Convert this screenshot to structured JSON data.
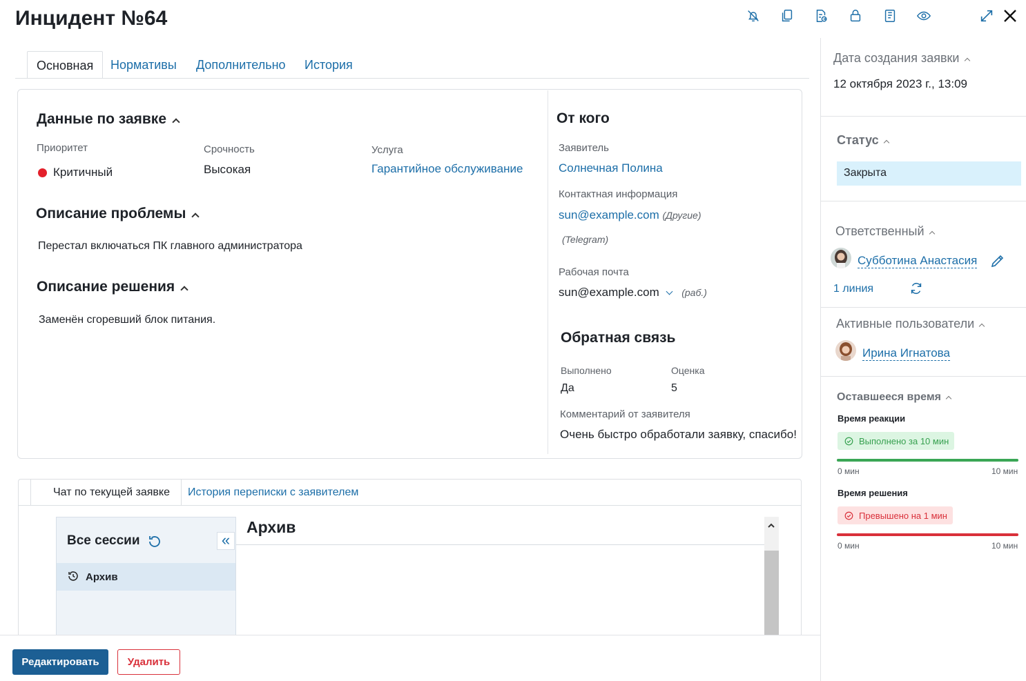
{
  "header": {
    "title": "Инцидент №64",
    "icons": [
      "bell-off-icon",
      "copy-icon",
      "document-move-icon",
      "lock-icon",
      "book-icon",
      "eye-icon",
      "expand-icon",
      "close-icon"
    ]
  },
  "tabs": [
    {
      "label": "Основная",
      "active": true
    },
    {
      "label": "Нормативы",
      "active": false
    },
    {
      "label": "Дополнительно",
      "active": false
    },
    {
      "label": "История",
      "active": false
    }
  ],
  "request": {
    "title": "Данные по заявке",
    "priority_label": "Приоритет",
    "priority_value": "Критичный",
    "priority_color": "#e3202b",
    "urgency_label": "Срочность",
    "urgency_value": "Высокая",
    "service_label": "Услуга",
    "service_value": "Гарантийное обслуживание"
  },
  "problem": {
    "title": "Описание проблемы",
    "text": "Перестал включаться ПК главного администратора"
  },
  "solution": {
    "title": "Описание решения",
    "text": "Заменён сгоревший блок питания."
  },
  "from": {
    "title": "От кого",
    "applicant_label": "Заявитель",
    "applicant_value": "Солнечная Полина",
    "contact_label": "Контактная информация",
    "contact_email": "sun@example.com",
    "contact_email_note": "(Другие)",
    "contact_telegram_note": "(Telegram)",
    "work_email_label": "Рабочая почта",
    "work_email_value": "sun@example.com",
    "work_email_note": "(раб.)"
  },
  "feedback": {
    "title": "Обратная связь",
    "done_label": "Выполнено",
    "done_value": "Да",
    "rating_label": "Оценка",
    "rating_value": "5",
    "comment_label": "Комментарий от заявителя",
    "comment_value": "Очень быстро обработали заявку, спасибо!"
  },
  "chat": {
    "tabs": [
      {
        "label": "Чат по текущей заявке",
        "active": true
      },
      {
        "label": "История переписки с заявителем",
        "active": false
      }
    ],
    "sessions_title": "Все сессии",
    "session_item": "Архив",
    "panel_title": "Архив"
  },
  "buttons": {
    "edit": "Редактировать",
    "delete": "Удалить"
  },
  "sidebar": {
    "created_label": "Дата создания заявки",
    "created_value": "12 октября 2023 г., 13:09",
    "status_label": "Статус",
    "status_value": "Закрыта",
    "responsible_label": "Ответственный",
    "responsible_name": "Субботина Анастасия",
    "responsible_line": "1 линия",
    "active_users_label": "Активные пользователи",
    "active_user_name": "Ирина Игнатова",
    "remaining_label": "Оставшееся время",
    "reaction_label": "Время реакции",
    "reaction_badge": "Выполнено за 10 мин",
    "reaction_progress": 1.0,
    "reaction_color": "#3aa655",
    "reaction_min": "0 мин",
    "reaction_max": "10 мин",
    "solution_label": "Время решения",
    "solution_badge": "Превышено на 1 мин",
    "solution_progress": 1.0,
    "solution_color": "#d9303a",
    "solution_min": "0 мин",
    "solution_max": "10 мин"
  }
}
